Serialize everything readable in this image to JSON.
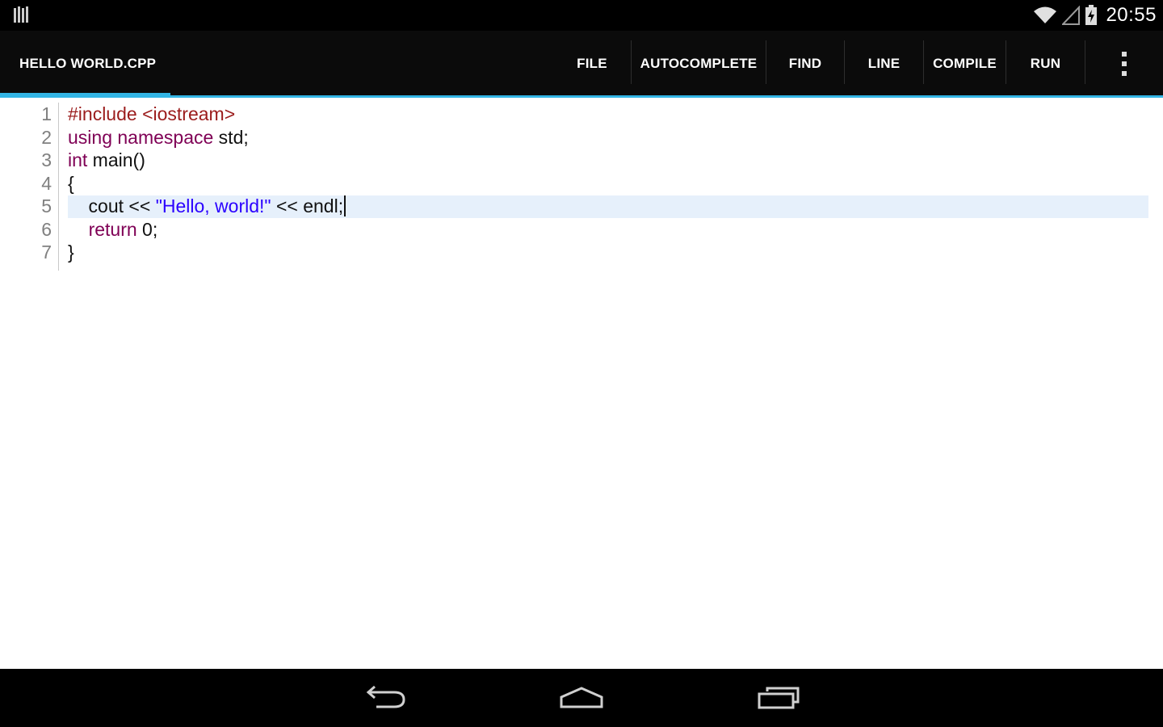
{
  "status_bar": {
    "time": "20:55",
    "icons": [
      "notification-icon",
      "wifi-icon",
      "signal-icon",
      "battery-charging-icon"
    ]
  },
  "action_bar": {
    "title": "HELLO WORLD.CPP",
    "actions": [
      "FILE",
      "AUTOCOMPLETE",
      "FIND",
      "LINE",
      "COMPILE",
      "RUN"
    ],
    "overflow_icon": "more-vert-icon",
    "accent_color": "#33b5e5"
  },
  "editor": {
    "line_numbers": [
      "1",
      "2",
      "3",
      "4",
      "5",
      "6",
      "7"
    ],
    "active_line": 5,
    "lines": [
      [
        {
          "text": "#include <iostream>",
          "type": "preprocessor"
        }
      ],
      [
        {
          "text": "using namespace",
          "type": "keyword"
        },
        {
          "text": " std;",
          "type": "plain"
        }
      ],
      [
        {
          "text": "int",
          "type": "keyword"
        },
        {
          "text": " main()",
          "type": "plain"
        }
      ],
      [
        {
          "text": "{",
          "type": "plain"
        }
      ],
      [
        {
          "text": "    cout << ",
          "type": "plain"
        },
        {
          "text": "\"Hello, world!\"",
          "type": "string"
        },
        {
          "text": " << endl;",
          "type": "plain"
        }
      ],
      [
        {
          "text": "    ",
          "type": "plain"
        },
        {
          "text": "return",
          "type": "keyword"
        },
        {
          "text": " 0;",
          "type": "plain"
        }
      ],
      [
        {
          "text": "}",
          "type": "plain"
        }
      ]
    ],
    "colors": {
      "keyword": "#7f0055",
      "preprocessor": "#9b1c1c",
      "string": "#2a00ff",
      "highlight": "#e6f0fb"
    }
  },
  "nav_bar": {
    "buttons": [
      "back-icon",
      "home-icon",
      "recent-apps-icon"
    ]
  }
}
